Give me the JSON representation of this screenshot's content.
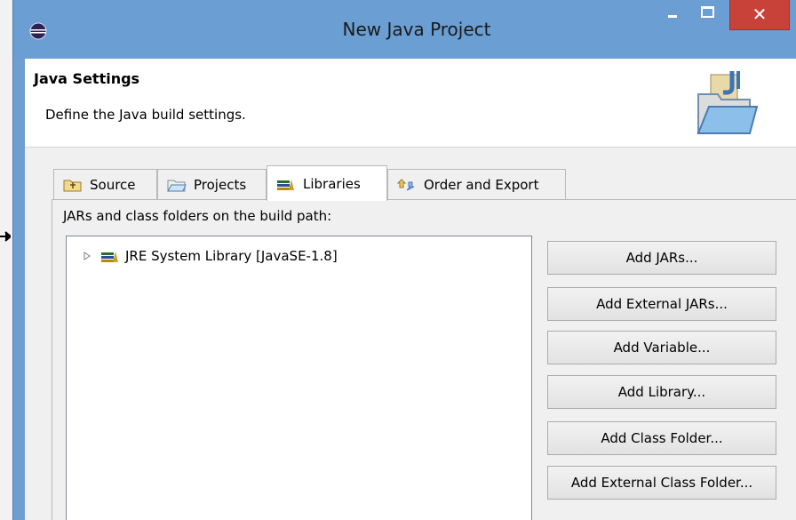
{
  "window": {
    "title": "New Java Project",
    "close_glyph": "✕"
  },
  "header": {
    "title": "Java Settings",
    "description": "Define the Java build settings."
  },
  "tabs": [
    {
      "label": "Source",
      "icon": "source-folder-icon",
      "selected": false
    },
    {
      "label": "Projects",
      "icon": "folder-icon",
      "selected": false
    },
    {
      "label": "Libraries",
      "icon": "library-icon",
      "selected": true
    },
    {
      "label": "Order and Export",
      "icon": "order-export-icon",
      "selected": false
    }
  ],
  "libraries": {
    "label": "JARs and class folders on the build path:",
    "tree_items": [
      {
        "label": "JRE System Library [JavaSE-1.8]",
        "icon": "library-icon",
        "expanded": false
      }
    ],
    "buttons": [
      {
        "label": "Add JARs..."
      },
      {
        "label": "Add External JARs..."
      },
      {
        "label": "Add Variable..."
      },
      {
        "label": "Add Library..."
      },
      {
        "label": "Add Class Folder..."
      },
      {
        "label": "Add External Class Folder..."
      }
    ]
  },
  "colors": {
    "titlebar": "#6b9ed2",
    "close_button": "#c9423a",
    "dialog_body": "#f0f0f0"
  }
}
